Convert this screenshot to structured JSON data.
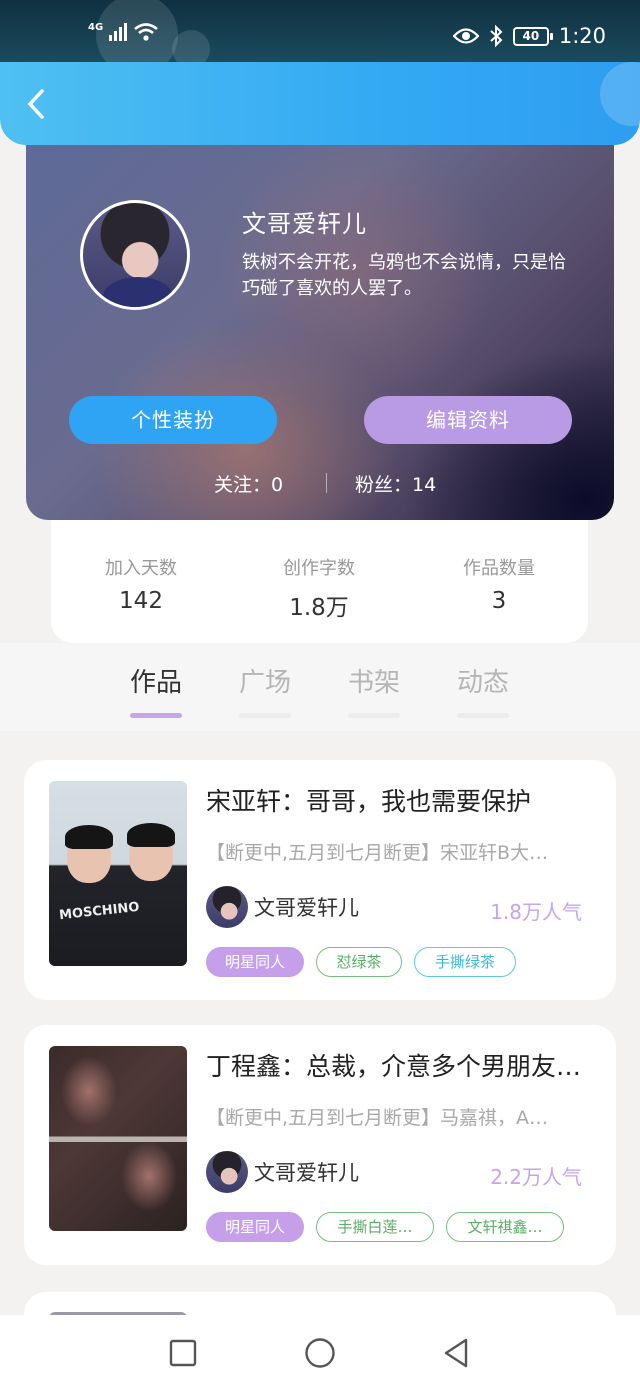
{
  "status_bar": {
    "network": "4G",
    "time": "1:20",
    "battery": "40",
    "icons": [
      "signal-icon",
      "wifi-icon",
      "eye-icon",
      "bluetooth-icon",
      "battery-icon"
    ]
  },
  "nav": {
    "back_icon": "chevron-left-icon"
  },
  "profile": {
    "name": "文哥爱轩儿",
    "bio": "铁树不会开花，乌鸦也不会说情，只是恰巧碰了喜欢的人罢了。",
    "buttons": {
      "dress_up": "个性装扮",
      "edit_profile": "编辑资料"
    },
    "follow": {
      "following": "关注：0",
      "fans": "粉丝：14"
    }
  },
  "stats": [
    {
      "label": "加入天数",
      "value": "142"
    },
    {
      "label": "创作字数",
      "value": "1.8万"
    },
    {
      "label": "作品数量",
      "value": "3"
    }
  ],
  "tabs": [
    {
      "label": "作品",
      "active": true
    },
    {
      "label": "广场",
      "active": false
    },
    {
      "label": "书架",
      "active": false
    },
    {
      "label": "动态",
      "active": false
    }
  ],
  "works": [
    {
      "title": "宋亚轩：哥哥，我也需要保护",
      "desc": "【断更中,五月到七月断更】宋亚轩B大…",
      "author": "文哥爱轩儿",
      "popularity": "1.8万人气",
      "cover_text": "MOSCHINO",
      "tags": [
        {
          "label": "明星同人",
          "style": "purple"
        },
        {
          "label": "怼绿茶",
          "style": "green"
        },
        {
          "label": "手撕绿茶",
          "style": "cyan"
        }
      ]
    },
    {
      "title": "丁程鑫：总裁，介意多个男朋友…",
      "desc": "【断更中,五月到七月断更】马嘉祺，A…",
      "author": "文哥爱轩儿",
      "popularity": "2.2万人气",
      "tags": [
        {
          "label": "明星同人",
          "style": "purple"
        },
        {
          "label": "手撕白莲…",
          "style": "green"
        },
        {
          "label": "文轩祺鑫…",
          "style": "green"
        }
      ]
    }
  ],
  "bottom_nav": [
    "recents-square-icon",
    "home-circle-icon",
    "back-triangle-icon"
  ],
  "colors": {
    "accent_blue": "#30a4f4",
    "accent_purple": "#b99ae4",
    "popularity": "#c8a4ec"
  }
}
